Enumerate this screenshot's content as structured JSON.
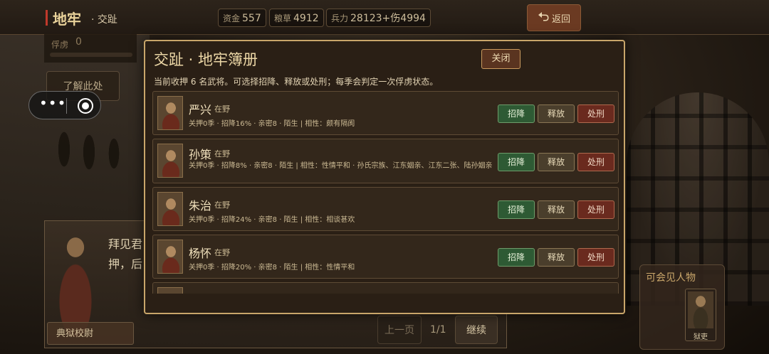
{
  "topbar": {
    "title": "地牢",
    "subtitle": "· 交趾",
    "stats": [
      {
        "label": "资金",
        "value": "557"
      },
      {
        "label": "粮草",
        "value": "4912"
      },
      {
        "label": "兵力",
        "value": "28123+伤4994"
      }
    ],
    "back_label": "返回"
  },
  "side": {
    "captives_label": "俘虏",
    "captives_value": "0",
    "learn_label": "了解此处"
  },
  "dialog": {
    "line1": "拜见君",
    "line2": "押，后",
    "speaker": "典狱校尉",
    "prev_label": "上一页",
    "page": "1/1",
    "next_label": "继续"
  },
  "meet": {
    "title": "可会见人物",
    "person": "狱吏"
  },
  "modal": {
    "title": "交趾 · 地牢簿册",
    "close_label": "关闭",
    "description": "当前收押 6 名武将。可选择招降、释放或处刑；每季会判定一次俘虏状态。",
    "actions": {
      "recruit": "招降",
      "release": "释放",
      "execute": "处刑"
    },
    "generals": [
      {
        "name": "严兴",
        "status": "在野",
        "detail": "关押0季 · 招降16% · 亲密8 · 陌生 | 相性：颇有隔阂"
      },
      {
        "name": "孙策",
        "status": "在野",
        "detail": "关押0季 · 招降8% · 亲密8 · 陌生 | 相性：性情平和 · 孙氏宗族、江东姻亲、江东二张、陆孙姻亲"
      },
      {
        "name": "朱治",
        "status": "在野",
        "detail": "关押0季 · 招降24% · 亲密8 · 陌生 | 相性：相谈甚欢"
      },
      {
        "name": "杨怀",
        "status": "在野",
        "detail": "关押0季 · 招降20% · 亲密8 · 陌生 | 相性：性情平和"
      }
    ]
  },
  "colors": {
    "accent_gold": "#c9a66a",
    "recruit_green": "#2e5a34",
    "execute_red": "#6a2a1e",
    "title_mark_red": "#c0392b"
  }
}
